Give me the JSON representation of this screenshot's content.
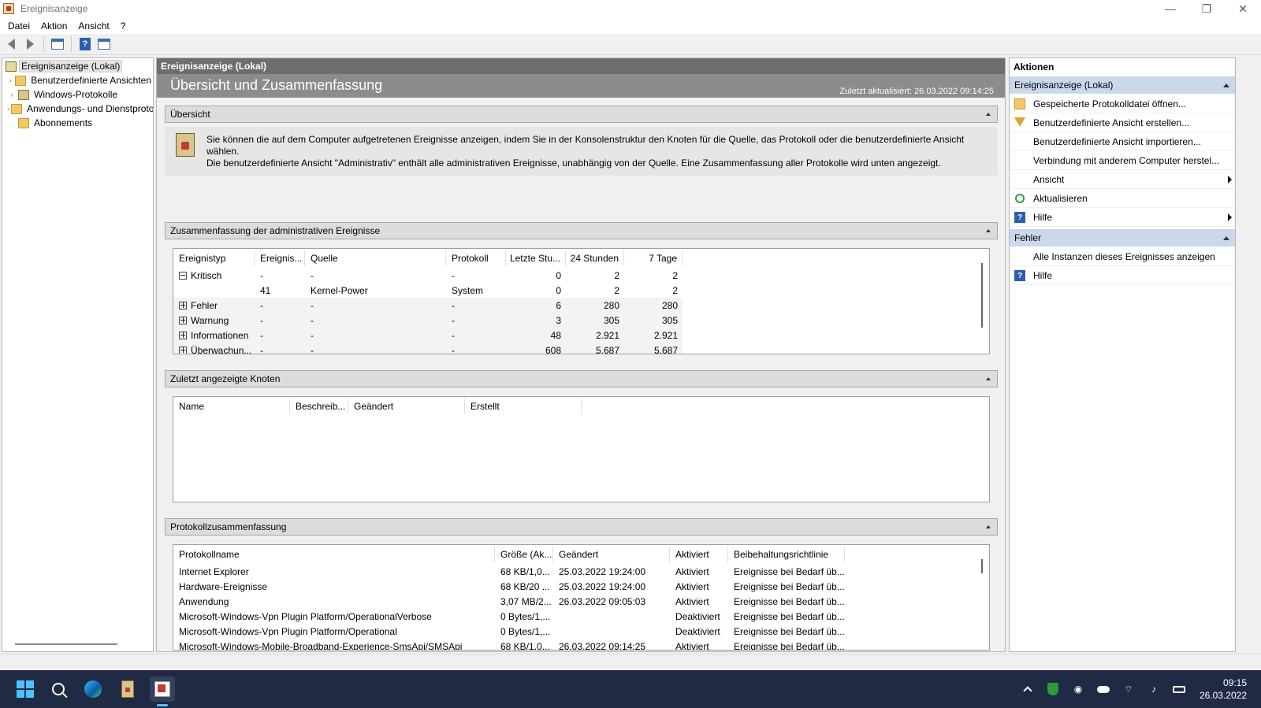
{
  "window": {
    "title": "Ereignisanzeige",
    "controls": [
      "—",
      "❐",
      "✕"
    ]
  },
  "menu": [
    "Datei",
    "Aktion",
    "Ansicht",
    "?"
  ],
  "tree": {
    "items": [
      {
        "label": "Ereignisanzeige (Lokal)",
        "selected": true
      },
      {
        "label": "Benutzerdefinierte Ansichten"
      },
      {
        "label": "Windows-Protokolle"
      },
      {
        "label": "Anwendungs- und Dienstprotokolle"
      },
      {
        "label": "Abonnements"
      }
    ]
  },
  "main": {
    "header": "Ereignisanzeige (Lokal)",
    "subtitle": "Übersicht und Zusammenfassung",
    "last_updated": "Zuletzt aktualisiert: 26.03.2022 09:14:25",
    "sections": {
      "overview": {
        "title": "Übersicht",
        "text_line1": "Sie können die auf dem Computer aufgetretenen Ereignisse anzeigen, indem Sie in der Konsolenstruktur den Knoten für die Quelle, das Protokoll oder die benutzerdefinierte Ansicht wählen.",
        "text_line2": "Die benutzerdefinierte Ansicht \"Administrativ\" enthält alle administrativen Ereignisse, unabhängig von der Quelle. Eine Zusammenfassung aller Protokolle wird unten angezeigt."
      },
      "admin_summary": {
        "title": "Zusammenfassung der administrativen Ereignisse",
        "columns": [
          "Ereignistyp",
          "Ereignis...",
          "Quelle",
          "Protokoll",
          "Letzte Stu...",
          "24 Stunden",
          "7 Tage"
        ],
        "rows": [
          {
            "type": "Kritisch",
            "toggle": "minus",
            "id": "-",
            "source": "-",
            "log": "-",
            "hour": "0",
            "day": "2",
            "week": "2"
          },
          {
            "type": "",
            "toggle": "",
            "id": "41",
            "source": "Kernel-Power",
            "log": "System",
            "hour": "0",
            "day": "2",
            "week": "2"
          },
          {
            "type": "Fehler",
            "toggle": "plus",
            "id": "-",
            "source": "-",
            "log": "-",
            "hour": "6",
            "day": "280",
            "week": "280"
          },
          {
            "type": "Warnung",
            "toggle": "plus",
            "id": "-",
            "source": "-",
            "log": "-",
            "hour": "3",
            "day": "305",
            "week": "305"
          },
          {
            "type": "Informationen",
            "toggle": "plus",
            "id": "-",
            "source": "-",
            "log": "-",
            "hour": "48",
            "day": "2.921",
            "week": "2.921"
          },
          {
            "type": "Überwachun...",
            "toggle": "plus",
            "id": "-",
            "source": "-",
            "log": "-",
            "hour": "608",
            "day": "5.687",
            "week": "5.687"
          }
        ]
      },
      "recent_nodes": {
        "title": "Zuletzt angezeigte Knoten",
        "columns": [
          "Name",
          "Beschreib...",
          "Geändert",
          "Erstellt"
        ]
      },
      "log_summary": {
        "title": "Protokollzusammenfassung",
        "columns": [
          "Protokollname",
          "Größe (Ak...",
          "Geändert",
          "Aktiviert",
          "Beibehaltungsrichtlinie"
        ],
        "rows": [
          {
            "name": "Internet Explorer",
            "size": "68 KB/1,0...",
            "changed": "25.03.2022 19:24:00",
            "enabled": "Aktiviert",
            "policy": "Ereignisse bei Bedarf üb..."
          },
          {
            "name": "Hardware-Ereignisse",
            "size": "68 KB/20 ...",
            "changed": "25.03.2022 19:24:00",
            "enabled": "Aktiviert",
            "policy": "Ereignisse bei Bedarf üb..."
          },
          {
            "name": "Anwendung",
            "size": "3,07 MB/2...",
            "changed": "26.03.2022 09:05:03",
            "enabled": "Aktiviert",
            "policy": "Ereignisse bei Bedarf üb..."
          },
          {
            "name": "Microsoft-Windows-Vpn Plugin Platform/OperationalVerbose",
            "size": "0 Bytes/1,...",
            "changed": "",
            "enabled": "Deaktiviert",
            "policy": "Ereignisse bei Bedarf üb..."
          },
          {
            "name": "Microsoft-Windows-Vpn Plugin Platform/Operational",
            "size": "0 Bytes/1,...",
            "changed": "",
            "enabled": "Deaktiviert",
            "policy": "Ereignisse bei Bedarf üb..."
          },
          {
            "name": "Microsoft-Windows-Mobile-Broadband-Experience-SmsApi/SMSApi",
            "size": "68 KB/1,0...",
            "changed": "26.03.2022 09:14:25",
            "enabled": "Aktiviert",
            "policy": "Ereignisse bei Bedarf üb..."
          }
        ]
      }
    }
  },
  "actions": {
    "title": "Aktionen",
    "group1": {
      "title": "Ereignisanzeige (Lokal)",
      "items": [
        {
          "label": "Gespeicherte Protokolldatei öffnen...",
          "icon": "open-folder-icon"
        },
        {
          "label": "Benutzerdefinierte Ansicht erstellen...",
          "icon": "filter-icon"
        },
        {
          "label": "Benutzerdefinierte Ansicht importieren...",
          "icon": ""
        },
        {
          "label": "Verbindung mit anderem Computer herstel...",
          "icon": ""
        },
        {
          "label": "Ansicht",
          "icon": "",
          "submenu": true
        },
        {
          "label": "Aktualisieren",
          "icon": "refresh-icon"
        },
        {
          "label": "Hilfe",
          "icon": "help-icon",
          "submenu": true
        }
      ]
    },
    "group2": {
      "title": "Fehler",
      "items": [
        {
          "label": "Alle Instanzen dieses Ereignisses anzeigen",
          "icon": ""
        },
        {
          "label": "Hilfe",
          "icon": "help-icon"
        }
      ]
    }
  },
  "taskbar": {
    "time": "09:15",
    "date": "26.03.2022"
  },
  "colors": {
    "header_dark": "#6e6e6e",
    "header_mid": "#8c8c8c",
    "action_group": "#c9d8ea",
    "taskbar": "#202a44"
  }
}
